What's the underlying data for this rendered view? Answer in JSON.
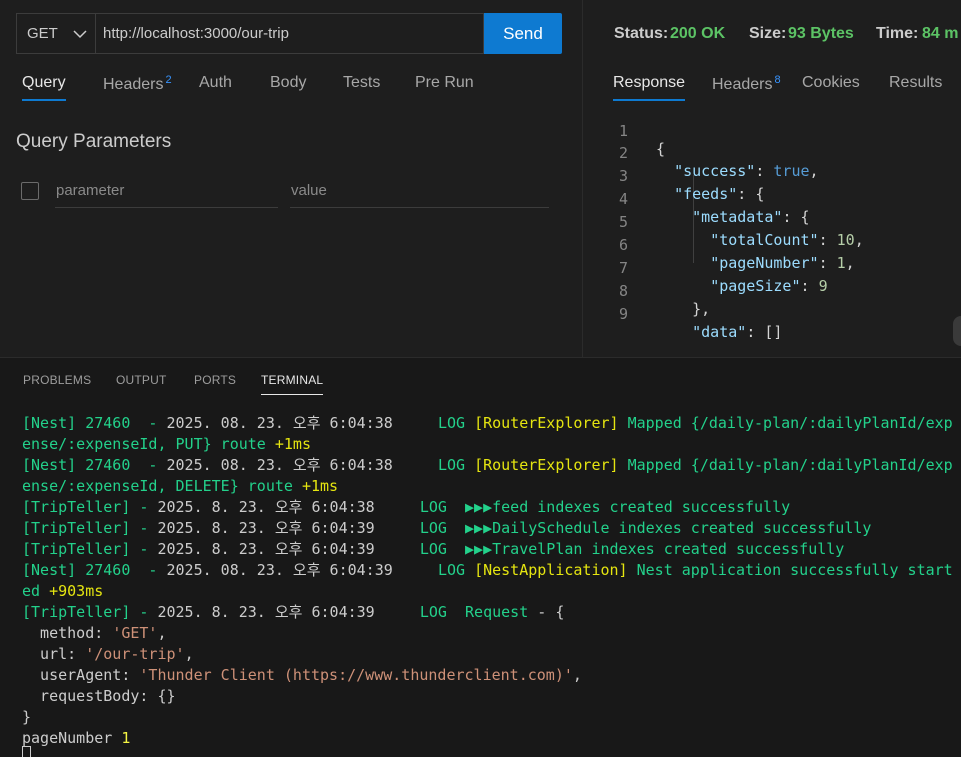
{
  "request": {
    "method": "GET",
    "url": "http://localhost:3000/our-trip",
    "send_label": "Send",
    "tabs": [
      {
        "label": "Query",
        "badge": ""
      },
      {
        "label": "Headers",
        "badge": "2"
      },
      {
        "label": "Auth",
        "badge": ""
      },
      {
        "label": "Body",
        "badge": ""
      },
      {
        "label": "Tests",
        "badge": ""
      },
      {
        "label": "Pre Run",
        "badge": ""
      }
    ],
    "active_tab": "Query",
    "query_title": "Query Parameters",
    "param_placeholder": "parameter",
    "value_placeholder": "value"
  },
  "response": {
    "status_label": "Status:",
    "status_value": "200 OK",
    "size_label": "Size:",
    "size_value": "93 Bytes",
    "time_label": "Time:",
    "time_value": "84 m",
    "tabs": [
      {
        "label": "Response",
        "badge": ""
      },
      {
        "label": "Headers",
        "badge": "8"
      },
      {
        "label": "Cookies",
        "badge": ""
      },
      {
        "label": "Results",
        "badge": ""
      }
    ],
    "active_tab": "Response",
    "line_numbers": [
      "1",
      "2",
      "3",
      "4",
      "5",
      "6",
      "7",
      "8",
      "9"
    ],
    "body_lines": [
      "{",
      "  \"success\": true,",
      "  \"feeds\": {",
      "    \"metadata\": {",
      "      \"totalCount\": 10,",
      "      \"pageNumber\": 1,",
      "      \"pageSize\": 9",
      "    },",
      "    \"data\": []"
    ],
    "tokens": {
      "success_key": "\"success\"",
      "true": "true",
      "feeds_key": "\"feeds\"",
      "metadata_key": "\"metadata\"",
      "totalCount_key": "\"totalCount\"",
      "totalCount_val": "10",
      "pageNumber_key": "\"pageNumber\"",
      "pageNumber_val": "1",
      "pageSize_key": "\"pageSize\"",
      "pageSize_val": "9",
      "data_key": "\"data\"",
      "data_val": "[]"
    }
  },
  "panel": {
    "tabs": [
      "PROBLEMS",
      "OUTPUT",
      "PORTS",
      "TERMINAL"
    ],
    "active_tab": "TERMINAL"
  },
  "terminal": {
    "nest": "[Nest] 27460  - ",
    "tripteller": "[TripTeller] - ",
    "ts1": "2025. 08. 23. 오후 6:04:38     ",
    "ts2": "2025. 08. 23. 오후 6:04:38     ",
    "ts3": "2025. 8. 23. 오후 6:04:38     ",
    "ts4": "2025. 8. 23. 오후 6:04:39     ",
    "ts5": "2025. 8. 23. 오후 6:04:39     ",
    "ts6": "2025. 08. 23. 오후 6:04:39     ",
    "ts7": "2025. 8. 23. 오후 6:04:39     ",
    "log": "LOG",
    "router_ctx": "[RouterExplorer]",
    "nestapp_ctx": "[NestApplication]",
    "mapped_put_1": " Mapped {/daily-plan/:dailyPlanId/exp",
    "mapped_put_2": "ense/:expenseId, PUT} route ",
    "mapped_del_1": " Mapped {/daily-plan/:dailyPlanId/exp",
    "mapped_del_2": "ense/:expenseId, DELETE} route ",
    "plus1": "+1ms",
    "arrows": "▶▶▶",
    "feed_msg": "feed indexes created successfully",
    "daily_msg": "DailySchedule indexes created successfully",
    "travel_msg": "TravelPlan indexes created successfully",
    "started_1": " Nest application successfully start",
    "started_2": "ed ",
    "plus903": "+903ms",
    "request_msg": "Request",
    "request_tail": " - {",
    "method_key": "  method: ",
    "method_val": "'GET'",
    "url_key": "  url: ",
    "url_val": "'/our-trip'",
    "ua_key": "  userAgent: ",
    "ua_val": "'Thunder Client (https://www.thunderclient.com)'",
    "rb_line": "  requestBody: {}",
    "close_brace": "}",
    "pagenumber_label": "pageNumber ",
    "pagenumber_val": "1",
    "comma": ","
  }
}
